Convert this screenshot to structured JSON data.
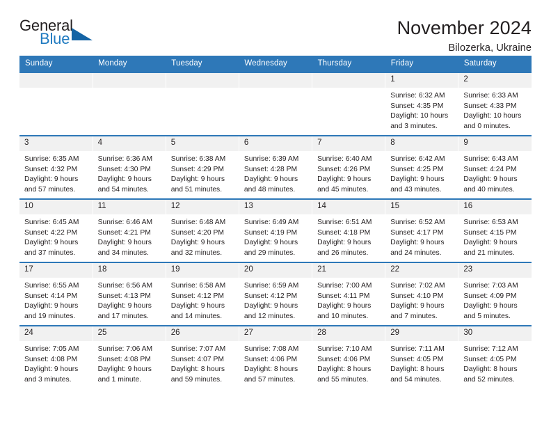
{
  "brand": {
    "word_one": "General",
    "word_two": "Blue",
    "triangle_icon": "triangle-icon",
    "accent_color": "#1464a5",
    "blue_text_color": "#1f7ac0"
  },
  "header": {
    "title": "November 2024",
    "location": "Bilozerka, Ukraine"
  },
  "calendar": {
    "header_bg": "#2e78b8",
    "daynum_bg": "#f1f1f1",
    "weekdays": [
      "Sunday",
      "Monday",
      "Tuesday",
      "Wednesday",
      "Thursday",
      "Friday",
      "Saturday"
    ],
    "labels": {
      "sunrise": "Sunrise:",
      "sunset": "Sunset:",
      "daylight": "Daylight:"
    },
    "weeks": [
      [
        {
          "day": "",
          "sunrise": "",
          "sunset": "",
          "daylight_a": "",
          "daylight_b": ""
        },
        {
          "day": "",
          "sunrise": "",
          "sunset": "",
          "daylight_a": "",
          "daylight_b": ""
        },
        {
          "day": "",
          "sunrise": "",
          "sunset": "",
          "daylight_a": "",
          "daylight_b": ""
        },
        {
          "day": "",
          "sunrise": "",
          "sunset": "",
          "daylight_a": "",
          "daylight_b": ""
        },
        {
          "day": "",
          "sunrise": "",
          "sunset": "",
          "daylight_a": "",
          "daylight_b": ""
        },
        {
          "day": "1",
          "sunrise": "Sunrise: 6:32 AM",
          "sunset": "Sunset: 4:35 PM",
          "daylight_a": "Daylight: 10 hours",
          "daylight_b": "and 3 minutes."
        },
        {
          "day": "2",
          "sunrise": "Sunrise: 6:33 AM",
          "sunset": "Sunset: 4:33 PM",
          "daylight_a": "Daylight: 10 hours",
          "daylight_b": "and 0 minutes."
        }
      ],
      [
        {
          "day": "3",
          "sunrise": "Sunrise: 6:35 AM",
          "sunset": "Sunset: 4:32 PM",
          "daylight_a": "Daylight: 9 hours",
          "daylight_b": "and 57 minutes."
        },
        {
          "day": "4",
          "sunrise": "Sunrise: 6:36 AM",
          "sunset": "Sunset: 4:30 PM",
          "daylight_a": "Daylight: 9 hours",
          "daylight_b": "and 54 minutes."
        },
        {
          "day": "5",
          "sunrise": "Sunrise: 6:38 AM",
          "sunset": "Sunset: 4:29 PM",
          "daylight_a": "Daylight: 9 hours",
          "daylight_b": "and 51 minutes."
        },
        {
          "day": "6",
          "sunrise": "Sunrise: 6:39 AM",
          "sunset": "Sunset: 4:28 PM",
          "daylight_a": "Daylight: 9 hours",
          "daylight_b": "and 48 minutes."
        },
        {
          "day": "7",
          "sunrise": "Sunrise: 6:40 AM",
          "sunset": "Sunset: 4:26 PM",
          "daylight_a": "Daylight: 9 hours",
          "daylight_b": "and 45 minutes."
        },
        {
          "day": "8",
          "sunrise": "Sunrise: 6:42 AM",
          "sunset": "Sunset: 4:25 PM",
          "daylight_a": "Daylight: 9 hours",
          "daylight_b": "and 43 minutes."
        },
        {
          "day": "9",
          "sunrise": "Sunrise: 6:43 AM",
          "sunset": "Sunset: 4:24 PM",
          "daylight_a": "Daylight: 9 hours",
          "daylight_b": "and 40 minutes."
        }
      ],
      [
        {
          "day": "10",
          "sunrise": "Sunrise: 6:45 AM",
          "sunset": "Sunset: 4:22 PM",
          "daylight_a": "Daylight: 9 hours",
          "daylight_b": "and 37 minutes."
        },
        {
          "day": "11",
          "sunrise": "Sunrise: 6:46 AM",
          "sunset": "Sunset: 4:21 PM",
          "daylight_a": "Daylight: 9 hours",
          "daylight_b": "and 34 minutes."
        },
        {
          "day": "12",
          "sunrise": "Sunrise: 6:48 AM",
          "sunset": "Sunset: 4:20 PM",
          "daylight_a": "Daylight: 9 hours",
          "daylight_b": "and 32 minutes."
        },
        {
          "day": "13",
          "sunrise": "Sunrise: 6:49 AM",
          "sunset": "Sunset: 4:19 PM",
          "daylight_a": "Daylight: 9 hours",
          "daylight_b": "and 29 minutes."
        },
        {
          "day": "14",
          "sunrise": "Sunrise: 6:51 AM",
          "sunset": "Sunset: 4:18 PM",
          "daylight_a": "Daylight: 9 hours",
          "daylight_b": "and 26 minutes."
        },
        {
          "day": "15",
          "sunrise": "Sunrise: 6:52 AM",
          "sunset": "Sunset: 4:17 PM",
          "daylight_a": "Daylight: 9 hours",
          "daylight_b": "and 24 minutes."
        },
        {
          "day": "16",
          "sunrise": "Sunrise: 6:53 AM",
          "sunset": "Sunset: 4:15 PM",
          "daylight_a": "Daylight: 9 hours",
          "daylight_b": "and 21 minutes."
        }
      ],
      [
        {
          "day": "17",
          "sunrise": "Sunrise: 6:55 AM",
          "sunset": "Sunset: 4:14 PM",
          "daylight_a": "Daylight: 9 hours",
          "daylight_b": "and 19 minutes."
        },
        {
          "day": "18",
          "sunrise": "Sunrise: 6:56 AM",
          "sunset": "Sunset: 4:13 PM",
          "daylight_a": "Daylight: 9 hours",
          "daylight_b": "and 17 minutes."
        },
        {
          "day": "19",
          "sunrise": "Sunrise: 6:58 AM",
          "sunset": "Sunset: 4:12 PM",
          "daylight_a": "Daylight: 9 hours",
          "daylight_b": "and 14 minutes."
        },
        {
          "day": "20",
          "sunrise": "Sunrise: 6:59 AM",
          "sunset": "Sunset: 4:12 PM",
          "daylight_a": "Daylight: 9 hours",
          "daylight_b": "and 12 minutes."
        },
        {
          "day": "21",
          "sunrise": "Sunrise: 7:00 AM",
          "sunset": "Sunset: 4:11 PM",
          "daylight_a": "Daylight: 9 hours",
          "daylight_b": "and 10 minutes."
        },
        {
          "day": "22",
          "sunrise": "Sunrise: 7:02 AM",
          "sunset": "Sunset: 4:10 PM",
          "daylight_a": "Daylight: 9 hours",
          "daylight_b": "and 7 minutes."
        },
        {
          "day": "23",
          "sunrise": "Sunrise: 7:03 AM",
          "sunset": "Sunset: 4:09 PM",
          "daylight_a": "Daylight: 9 hours",
          "daylight_b": "and 5 minutes."
        }
      ],
      [
        {
          "day": "24",
          "sunrise": "Sunrise: 7:05 AM",
          "sunset": "Sunset: 4:08 PM",
          "daylight_a": "Daylight: 9 hours",
          "daylight_b": "and 3 minutes."
        },
        {
          "day": "25",
          "sunrise": "Sunrise: 7:06 AM",
          "sunset": "Sunset: 4:08 PM",
          "daylight_a": "Daylight: 9 hours",
          "daylight_b": "and 1 minute."
        },
        {
          "day": "26",
          "sunrise": "Sunrise: 7:07 AM",
          "sunset": "Sunset: 4:07 PM",
          "daylight_a": "Daylight: 8 hours",
          "daylight_b": "and 59 minutes."
        },
        {
          "day": "27",
          "sunrise": "Sunrise: 7:08 AM",
          "sunset": "Sunset: 4:06 PM",
          "daylight_a": "Daylight: 8 hours",
          "daylight_b": "and 57 minutes."
        },
        {
          "day": "28",
          "sunrise": "Sunrise: 7:10 AM",
          "sunset": "Sunset: 4:06 PM",
          "daylight_a": "Daylight: 8 hours",
          "daylight_b": "and 55 minutes."
        },
        {
          "day": "29",
          "sunrise": "Sunrise: 7:11 AM",
          "sunset": "Sunset: 4:05 PM",
          "daylight_a": "Daylight: 8 hours",
          "daylight_b": "and 54 minutes."
        },
        {
          "day": "30",
          "sunrise": "Sunrise: 7:12 AM",
          "sunset": "Sunset: 4:05 PM",
          "daylight_a": "Daylight: 8 hours",
          "daylight_b": "and 52 minutes."
        }
      ]
    ]
  }
}
